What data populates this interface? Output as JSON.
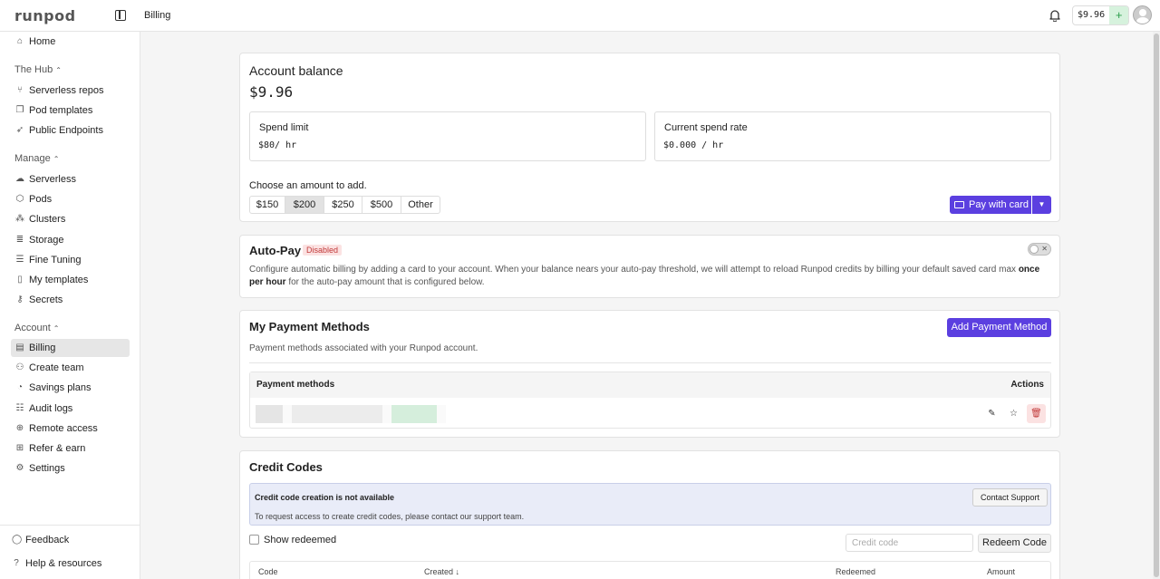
{
  "app": {
    "logo": "runpod",
    "breadcrumb": "Billing"
  },
  "topbar": {
    "balance": "$9.96",
    "add_funds_icon": "+"
  },
  "sidebar": {
    "home": "Home",
    "hub": {
      "heading": "The Hub",
      "items": [
        "Serverless repos",
        "Pod templates",
        "Public Endpoints"
      ]
    },
    "manage": {
      "heading": "Manage",
      "items": [
        "Serverless",
        "Pods",
        "Clusters",
        "Storage",
        "Fine Tuning",
        "My templates",
        "Secrets"
      ]
    },
    "account": {
      "heading": "Account",
      "items": [
        "Billing",
        "Create team",
        "Savings plans",
        "Audit logs",
        "Remote access",
        "Refer & earn",
        "Settings"
      ]
    },
    "footer": [
      "Feedback",
      "Help & resources"
    ]
  },
  "balance_card": {
    "title": "Account balance",
    "value": "$9.96",
    "spend_limit_label": "Spend limit",
    "spend_limit_value": "$80/ hr",
    "spend_rate_label": "Current spend rate",
    "spend_rate_value": "$0.000 / hr",
    "choose_label": "Choose an amount to add.",
    "amounts": [
      "$150",
      "$200",
      "$250",
      "$500",
      "Other"
    ],
    "selected_amount": "$200",
    "pay_button": "Pay with card"
  },
  "autopay": {
    "title": "Auto-Pay",
    "status": "Disabled",
    "desc_pre": "Configure automatic billing by adding a card to your account. When your balance nears your auto-pay threshold, we will attempt to reload Runpod credits by billing your default saved card max ",
    "desc_bold": "once per hour",
    "desc_post": " for the auto-pay amount that is configured below."
  },
  "payment_methods": {
    "title": "My Payment Methods",
    "add_button": "Add Payment Method",
    "subtitle": "Payment methods associated with your Runpod account.",
    "col_methods": "Payment methods",
    "col_actions": "Actions"
  },
  "credit_codes": {
    "title": "Credit Codes",
    "notice_title": "Credit code creation is not available",
    "notice_desc": "To request access to create credit codes, please contact our support team.",
    "contact_button": "Contact Support",
    "show_redeemed": "Show redeemed",
    "input_placeholder": "Credit code",
    "redeem_button": "Redeem Code",
    "columns": [
      "Code",
      "Created",
      "Redeemed",
      "Amount"
    ]
  }
}
